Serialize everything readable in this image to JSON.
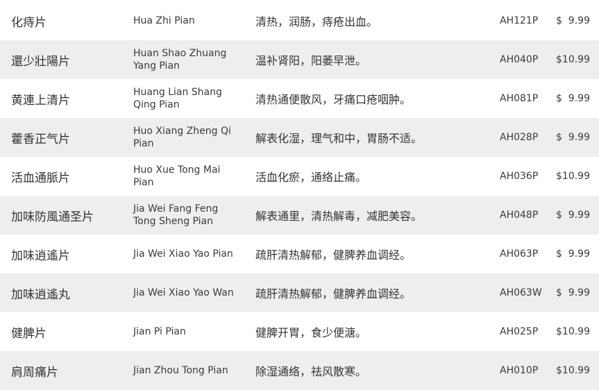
{
  "products": [
    {
      "name": "化痔片",
      "pinyin": "Hua Zhi Pian",
      "description": "清热，润肠，痔疮出血。",
      "code": "AH121P",
      "price": "$  9.99"
    },
    {
      "name": "還少壯陽片",
      "pinyin": "Huan Shao Zhuang Yang Pian",
      "description": "温补肾阳，阳萎早泄。",
      "code": "AH040P",
      "price": "$10.99"
    },
    {
      "name": "黄連上清片",
      "pinyin": "Huang Lian Shang Qing Pian",
      "description": "清热通便散风，牙痛口疮咽肿。",
      "code": "AH081P",
      "price": "$  9.99"
    },
    {
      "name": "藿香正气片",
      "pinyin": "Huo Xiang Zheng Qi Pian",
      "description": "解表化湿，理气和中，胃肠不适。",
      "code": "AH028P",
      "price": "$  9.99"
    },
    {
      "name": "活血通脈片",
      "pinyin": "Huo Xue Tong Mai Pian",
      "description": "活血化瘀，通络止痛。",
      "code": "AH036P",
      "price": "$10.99"
    },
    {
      "name": "加味防風通圣片",
      "pinyin": "Jia Wei Fang Feng Tong Sheng Pian",
      "description": "解表通里，清热解毒，减肥美容。",
      "code": "AH048P",
      "price": "$  9.99"
    },
    {
      "name": "加味逍遙片",
      "pinyin": "Jia Wei Xiao Yao Pian",
      "description": "疏肝清热解郁，健脾养血调经。",
      "code": "AH063P",
      "price": "$  9.99"
    },
    {
      "name": "加味逍遙丸",
      "pinyin": "Jia Wei Xiao Yao Wan",
      "description": "疏肝清热解郁，健脾养血调经。",
      "code": "AH063W",
      "price": "$  9.99"
    },
    {
      "name": "健脾片",
      "pinyin": "Jian Pi Pian",
      "description": "健脾开胃，食少便溏。",
      "code": "AH025P",
      "price": "$10.99"
    },
    {
      "name": "肩周痛片",
      "pinyin": "Jian Zhou Tong Pian",
      "description": "除湿通络，祛风散寒。",
      "code": "AH010P",
      "price": "$10.99"
    }
  ],
  "colors": {
    "row_shade": "#eeeeee",
    "row_plain": "#ffffff",
    "text": "#333333"
  }
}
